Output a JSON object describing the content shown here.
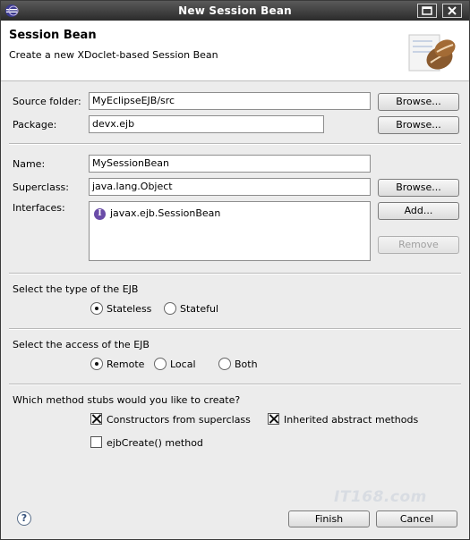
{
  "window": {
    "title": "New Session Bean"
  },
  "header": {
    "title": "Session Bean",
    "description": "Create a new XDoclet-based Session Bean"
  },
  "fields": {
    "source_folder": {
      "label": "Source folder:",
      "value": "MyEclipseEJB/src",
      "browse": "Browse..."
    },
    "package": {
      "label": "Package:",
      "value": "devx.ejb",
      "browse": "Browse..."
    },
    "name": {
      "label": "Name:",
      "value": "MySessionBean"
    },
    "superclass": {
      "label": "Superclass:",
      "value": "java.lang.Object",
      "browse": "Browse..."
    },
    "interfaces": {
      "label": "Interfaces:",
      "items": [
        "javax.ejb.SessionBean"
      ],
      "add": "Add...",
      "remove": "Remove"
    }
  },
  "ejb_type": {
    "prompt": "Select the type of the EJB",
    "options": [
      "Stateless",
      "Stateful"
    ],
    "selected": "Stateless"
  },
  "ejb_access": {
    "prompt": "Select the access of the EJB",
    "options": [
      "Remote",
      "Local",
      "Both"
    ],
    "selected": "Remote"
  },
  "stubs": {
    "prompt": "Which method stubs would you like to create?",
    "constructors": {
      "label": "Constructors from superclass",
      "checked": true
    },
    "inherited": {
      "label": "Inherited abstract methods",
      "checked": true
    },
    "ejbcreate": {
      "label": "ejbCreate() method",
      "checked": false
    }
  },
  "footer": {
    "help": "?",
    "finish": "Finish",
    "cancel": "Cancel"
  },
  "watermark": "IT168.com",
  "colors": {
    "titlebar": "#3a3a3a",
    "panel": "#ececec",
    "interface_icon": "#6a4ca8"
  },
  "icons": [
    "eclipse-icon",
    "maximize-icon",
    "close-icon",
    "bean-icon",
    "interface-icon",
    "help-icon"
  ]
}
